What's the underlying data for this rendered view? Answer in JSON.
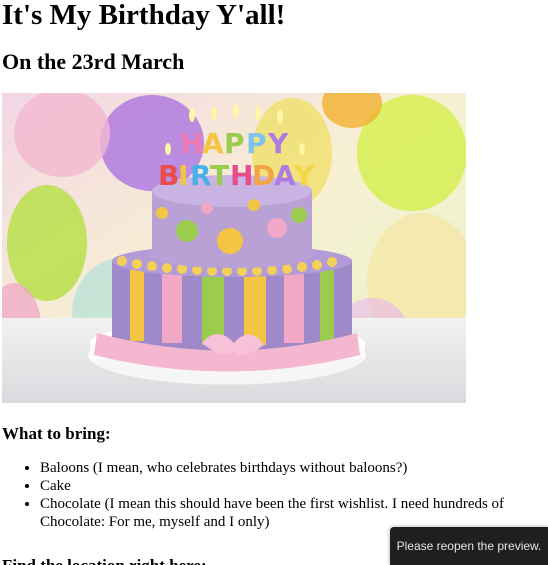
{
  "header": {
    "title": "It's My Birthday Y'all!",
    "subtitle": "On the 23rd March"
  },
  "image": {
    "alt": "Birthday cake",
    "topper_letters": [
      "H",
      "A",
      "P",
      "P",
      "Y"
    ],
    "topper_letters_2": [
      "B",
      "I",
      "R",
      "T",
      "H",
      "D",
      "A",
      "Y"
    ],
    "colors": {
      "cake_top": "#b9a1d6",
      "cake_bottom": "#9f89c8",
      "ribbon": "#f5b6cf",
      "stripe_yellow": "#f4c542",
      "stripe_green": "#9ccc4e",
      "table": "#e9e9ea"
    }
  },
  "bring": {
    "heading": "What to bring:",
    "items": [
      "Baloons (I mean, who celebrates birthdays without baloons?)",
      "Cake",
      "Chocolate (I mean this should have been the first wishlist. I need hundreds of Chocolate: For me, myself and I only)"
    ]
  },
  "next_section": {
    "heading": "Find the location right here:"
  },
  "toast": {
    "message": "Please reopen the preview."
  }
}
